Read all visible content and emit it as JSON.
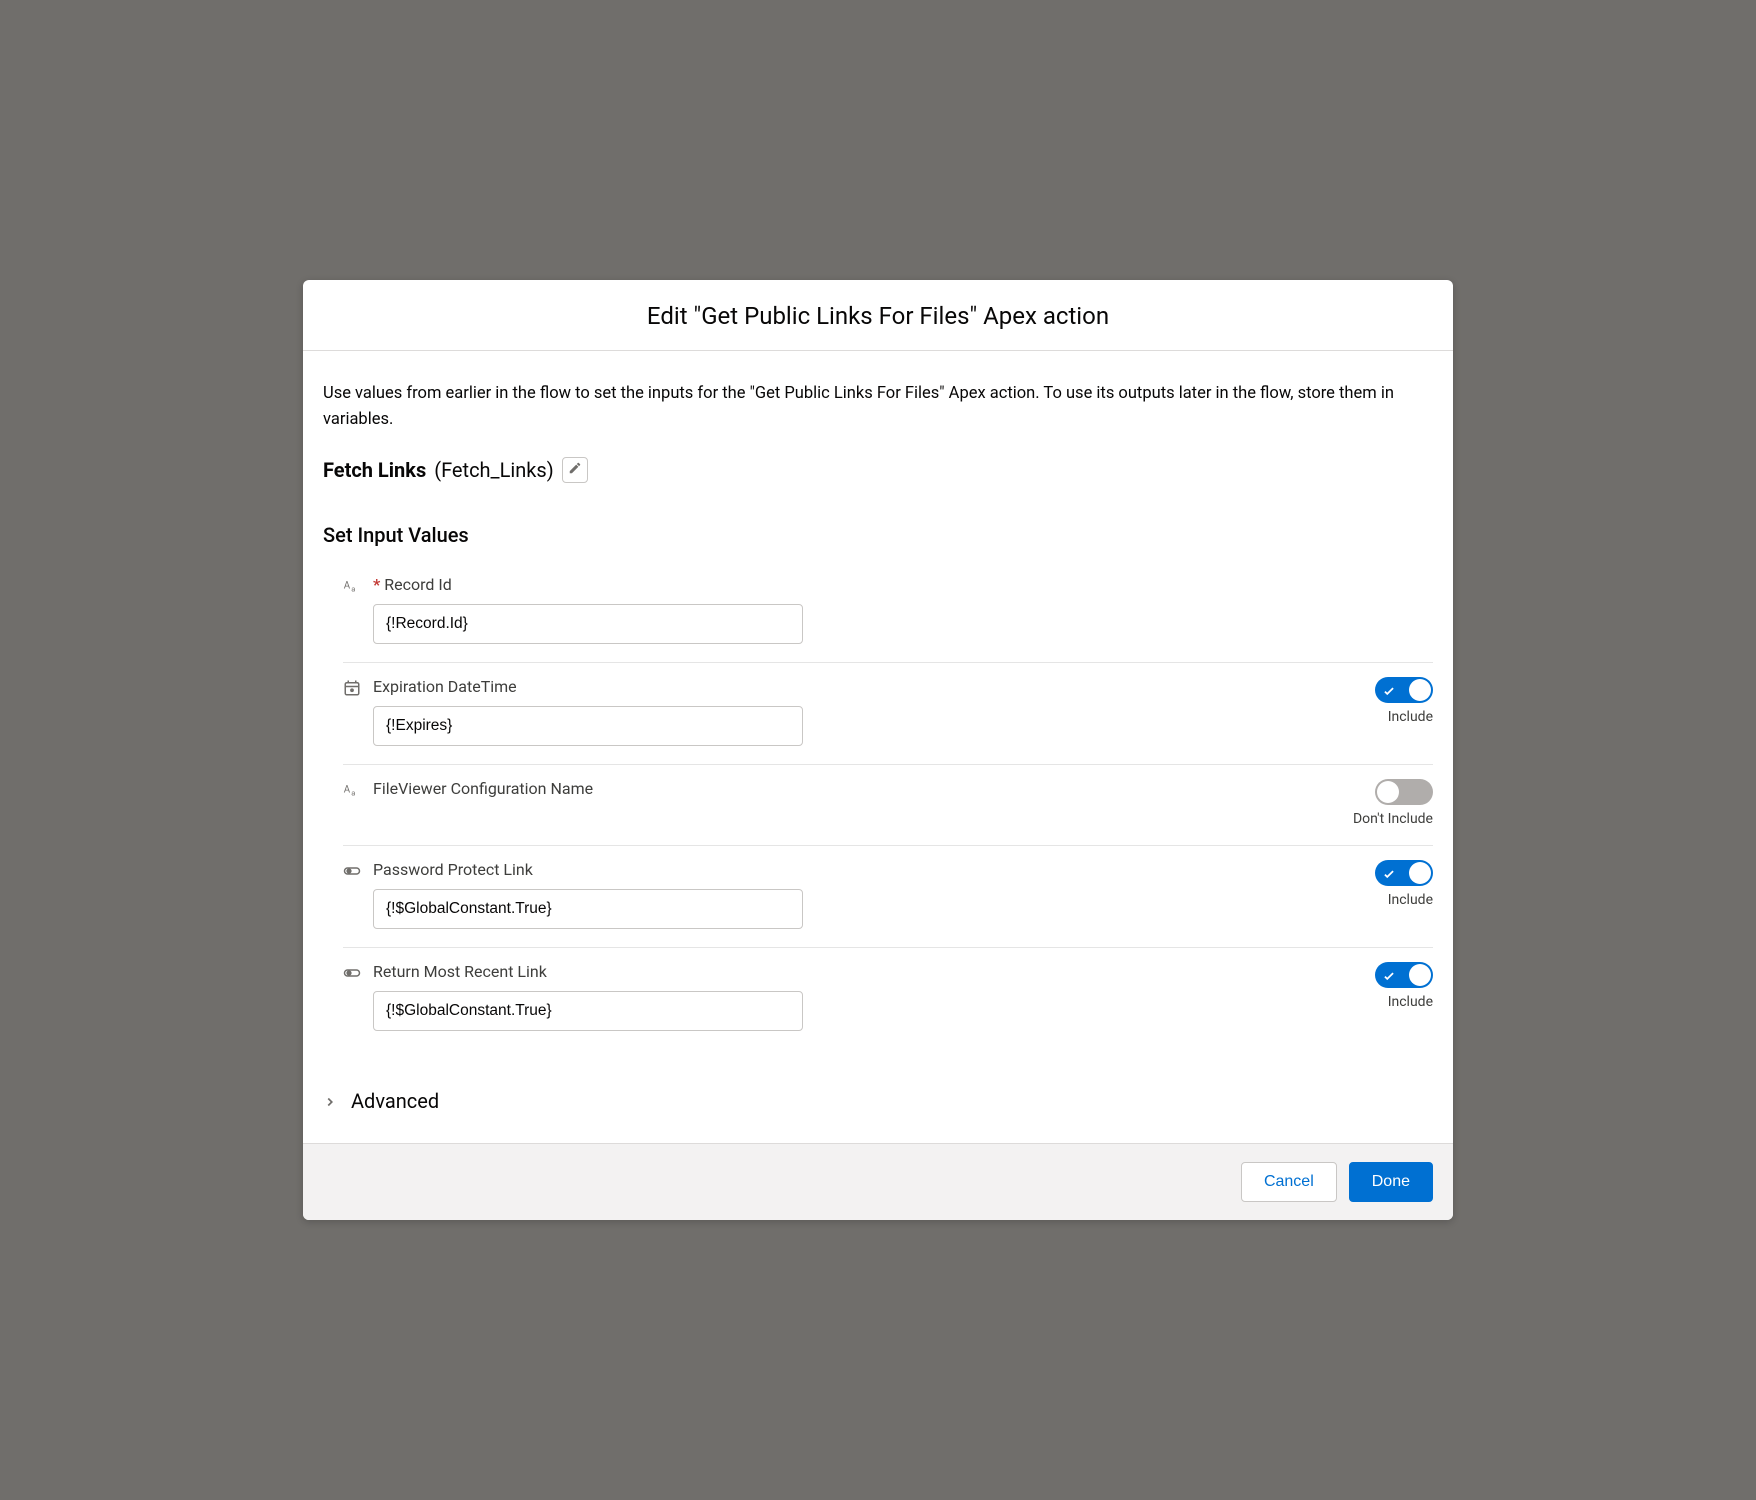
{
  "modal": {
    "title": "Edit \"Get Public Links For Files\" Apex action",
    "description": "Use values from earlier in the flow to set the inputs for the \"Get Public Links For Files\" Apex action. To use its outputs later in the flow, store them in variables.",
    "action_label": "Fetch Links",
    "action_api": "(Fetch_Links)",
    "section_title": "Set Input Values",
    "advanced_label": "Advanced"
  },
  "toggle_labels": {
    "include": "Include",
    "dont_include": "Don't Include"
  },
  "fields": {
    "record_id": {
      "label": "Record Id",
      "value": "{!Record.Id}",
      "required": true
    },
    "expiration": {
      "label": "Expiration DateTime",
      "value": "{!Expires}"
    },
    "fv_config": {
      "label": "FileViewer Configuration Name"
    },
    "password_protect": {
      "label": "Password Protect Link",
      "value": "{!$GlobalConstant.True}"
    },
    "return_recent": {
      "label": "Return Most Recent Link",
      "value": "{!$GlobalConstant.True}"
    }
  },
  "buttons": {
    "cancel": "Cancel",
    "done": "Done"
  }
}
